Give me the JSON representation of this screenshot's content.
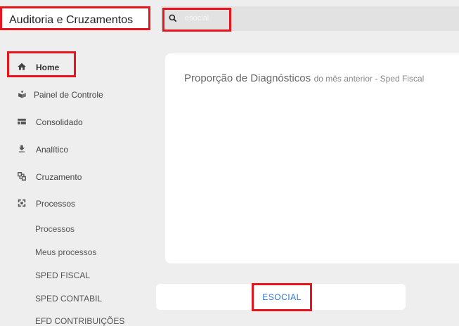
{
  "header": {
    "app_title": "Auditoria e Cruzamentos",
    "search_value": "esocial"
  },
  "sidebar": {
    "items": [
      {
        "label": "Home",
        "icon": "home-icon"
      },
      {
        "label": "Painel de Controle",
        "icon": "dashboard-icon"
      },
      {
        "label": "Consolidado",
        "icon": "table-icon"
      },
      {
        "label": "Analítico",
        "icon": "download-icon"
      },
      {
        "label": "Cruzamento",
        "icon": "crossing-icon"
      },
      {
        "label": "Processos",
        "icon": "process-icon"
      }
    ],
    "sub_items": [
      {
        "label": "Processos"
      },
      {
        "label": "Meus processos"
      },
      {
        "label": "SPED FISCAL"
      },
      {
        "label": "SPED CONTABIL"
      },
      {
        "label": "EFD CONTRIBUIÇÕES"
      }
    ]
  },
  "card": {
    "title": "Proporção de Diagnósticos",
    "subtitle": "do mês anterior - Sped Fiscal"
  },
  "bottom": {
    "button_label": "ESOCIAL"
  },
  "colors": {
    "highlight": "#e8141b",
    "link": "#2a7ad4",
    "background": "#eeeeee"
  }
}
